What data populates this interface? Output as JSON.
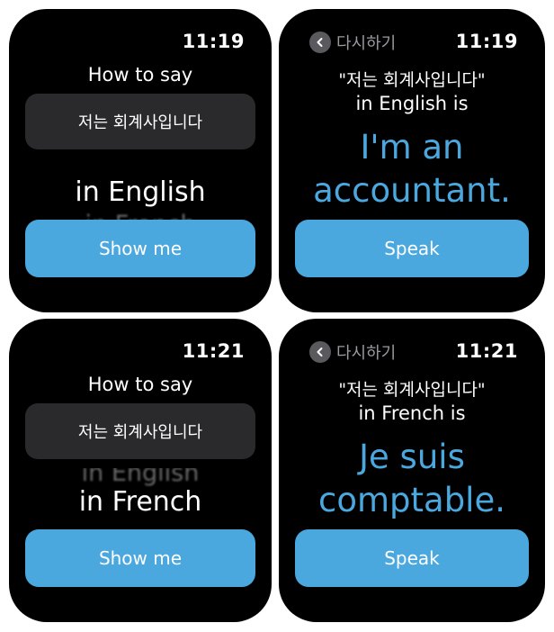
{
  "colors": {
    "accent": "#4aa8df",
    "background": "#000000",
    "card": "#2a2a2c"
  },
  "screens": [
    {
      "time": "11:19",
      "how_to_say": "How to say",
      "phrase": "저는 회계사입니다",
      "language_selected": "in English",
      "language_next": "in French",
      "button_label": "Show me"
    },
    {
      "time": "11:19",
      "back_label": "다시하기",
      "quote": "\"저는 회계사입니다\"",
      "is_line": "in English is",
      "answer_line1": "I'm an",
      "answer_line2": "accountant.",
      "button_label": "Speak"
    },
    {
      "time": "11:21",
      "how_to_say": "How to say",
      "phrase": "저는 회계사입니다",
      "language_prev": "in English",
      "language_selected": "in French",
      "button_label": "Show me"
    },
    {
      "time": "11:21",
      "back_label": "다시하기",
      "quote": "\"저는 회계사입니다\"",
      "is_line": "in French is",
      "answer_line1": "Je suis",
      "answer_line2": "comptable.",
      "button_label": "Speak"
    }
  ]
}
